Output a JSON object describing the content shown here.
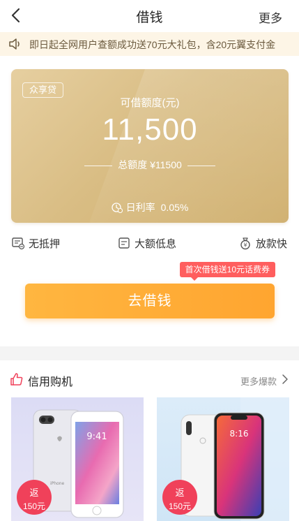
{
  "nav": {
    "title": "借钱",
    "more_label": "更多"
  },
  "notice": {
    "text": "即日起全网用户查额成功送70元大礼包，含20元翼支付金"
  },
  "card": {
    "tag": "众享贷",
    "label": "可借额度(元)",
    "amount": "11,500",
    "total": "总额度 ¥11500",
    "rate_label": "日利率",
    "rate_value": "0.05%"
  },
  "features": [
    {
      "label": "无抵押"
    },
    {
      "label": "大额低息"
    },
    {
      "label": "放款快"
    }
  ],
  "promo": {
    "text": "首次借钱送10元话费券"
  },
  "borrow_button": {
    "label": "去借钱"
  },
  "section": {
    "title": "信用购机",
    "more_label": "更多爆款"
  },
  "products": [
    {
      "badge_top": "返",
      "badge_bottom": "150元",
      "phone_brand": "iPhone",
      "screen_time": "9:41"
    },
    {
      "badge_top": "返",
      "badge_bottom": "150元",
      "screen_time": "8:16"
    }
  ],
  "colors": {
    "accent": "#ffaa33",
    "gold": "#d9bd84",
    "promo": "#ff5e5e",
    "badge": "#f0415a"
  }
}
